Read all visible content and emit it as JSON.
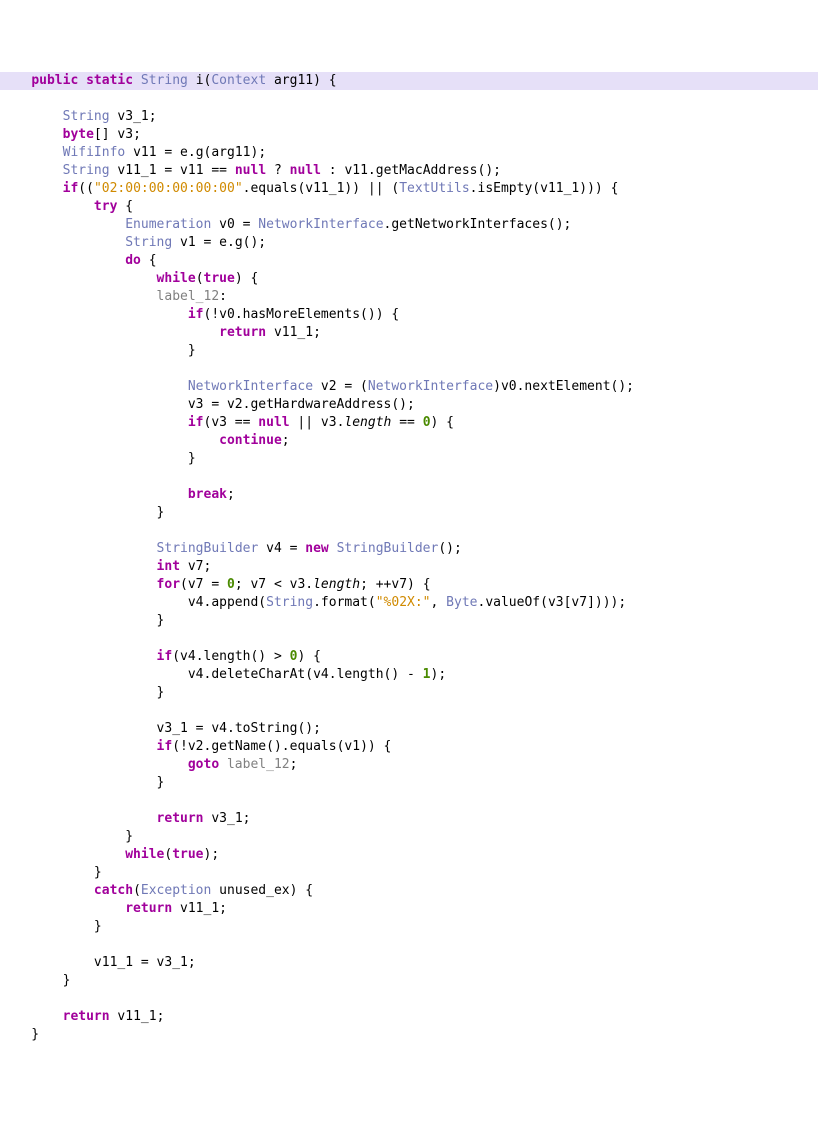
{
  "kw": {
    "public": "public",
    "static": "static",
    "if": "if",
    "try": "try",
    "do": "do",
    "while": "while",
    "true": "true",
    "return": "return",
    "continue": "continue",
    "break": "break",
    "new": "new",
    "int": "int",
    "for": "for",
    "goto": "goto",
    "catch": "catch",
    "null": "null",
    "byte": "byte"
  },
  "types": {
    "String": "String",
    "Context": "Context",
    "WifiInfo": "WifiInfo",
    "Enumeration": "Enumeration",
    "NetworkInterface": "NetworkInterface",
    "TextUtils": "TextUtils",
    "StringBuilder": "StringBuilder",
    "Byte": "Byte",
    "Exception": "Exception"
  },
  "ids": {
    "i": "i",
    "arg11": "arg11",
    "v3_1": "v3_1",
    "v3": "v3",
    "v11": "v11",
    "e": "e",
    "g": "g",
    "v11_1": "v11_1",
    "getMacAddress": "getMacAddress",
    "equals": "equals",
    "isEmpty": "isEmpty",
    "v0": "v0",
    "getNetworkInterfaces": "getNetworkInterfaces",
    "v1": "v1",
    "label_12": "label_12",
    "hasMoreElements": "hasMoreElements",
    "v2": "v2",
    "nextElement": "nextElement",
    "getHardwareAddress": "getHardwareAddress",
    "length": "length",
    "v4": "v4",
    "v7": "v7",
    "append": "append",
    "format": "format",
    "valueOf": "valueOf",
    "deleteCharAt": "deleteCharAt",
    "toString": "toString",
    "getName": "getName",
    "unused_ex": "unused_ex"
  },
  "strs": {
    "mac": "\"02:00:00:00:00:00\"",
    "fmt": "\"%02X:\""
  },
  "nums": {
    "zero": "0",
    "one": "1"
  }
}
